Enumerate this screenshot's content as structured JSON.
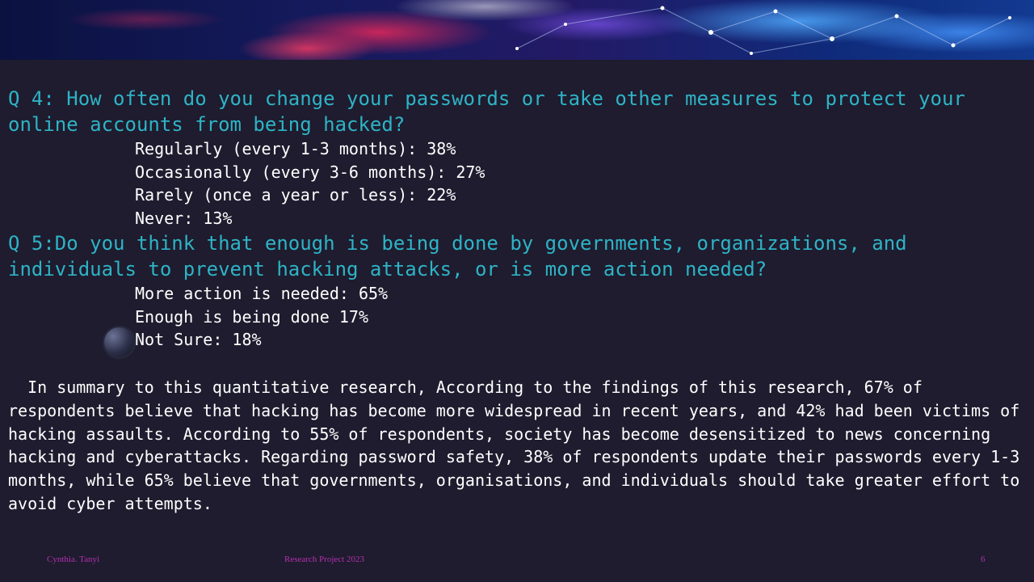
{
  "questions": [
    {
      "title": "Q 4: How often do you change your passwords or take other measures to protect your online accounts from being hacked?",
      "answers": [
        "Regularly (every 1-3 months): 38%",
        "Occasionally (every 3-6 months): 27%",
        "Rarely (once a year or less): 22%",
        "Never: 13%"
      ]
    },
    {
      "title": "Q 5:Do you think that enough is being done by governments, organizations, and individuals to prevent hacking attacks, or is more action needed?",
      "answers": [
        "More action is needed: 65%",
        "Enough is being done 17%",
        "Not Sure: 18%"
      ]
    }
  ],
  "summary": "  In summary to this quantitative research, According to the findings of this research, 67% of respondents believe that hacking has become more widespread in recent years, and 42% had been victims of hacking assaults. According to 55% of respondents, society has become desensitized to news concerning hacking and cyberattacks. Regarding password safety, 38% of respondents update their passwords every 1-3 months, while 65% believe that governments, organisations, and individuals should take greater effort to avoid cyber attempts.",
  "footer": {
    "author": "Cynthia. Tanyi",
    "project": "Research Project 2023",
    "page_number": "6"
  },
  "colors": {
    "background": "#1e1c2e",
    "question_text": "#2fb3c6",
    "body_text": "#ffffff",
    "footer_text": "#b52fb0"
  }
}
